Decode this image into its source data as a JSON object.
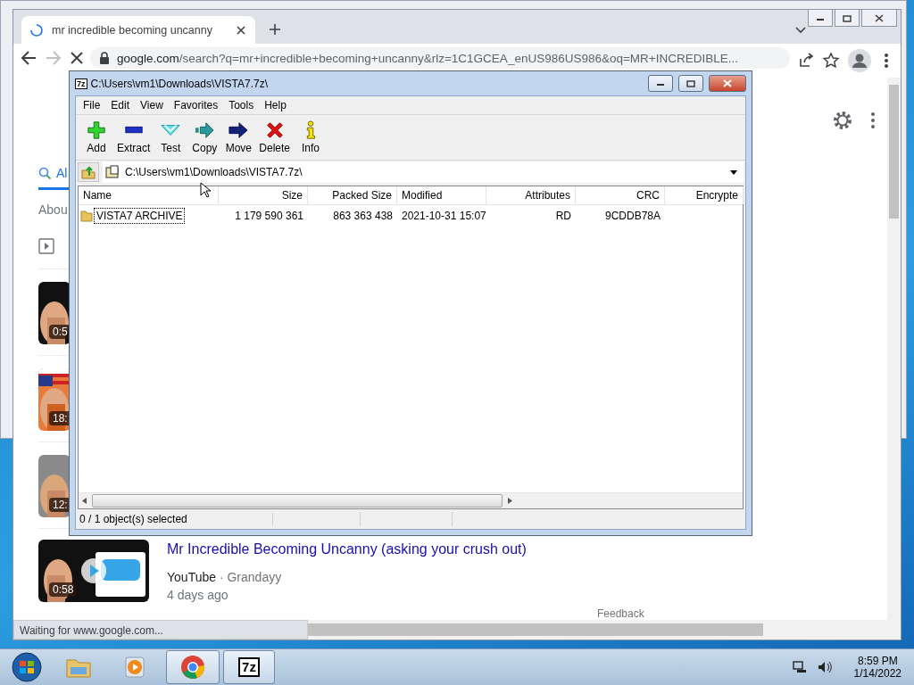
{
  "browser": {
    "tab": {
      "title": "mr incredible becoming uncanny",
      "selected": true
    },
    "address_host": "google.com",
    "address_rest": "/search?q=mr+incredible+becoming+uncanny&rlz=1C1GCEA_enUS986US986&oq=MR+INCREDIBLE...",
    "search_tab": "Al",
    "result_info": "Abou",
    "video_durations": [
      "0:5",
      "18:",
      "12:"
    ],
    "result": {
      "duration": "0:58",
      "title": "Mr Incredible Becoming Uncanny (asking your crush out)",
      "source": "YouTube",
      "separator": "·",
      "channel": "Grandayy",
      "age": "4 days ago"
    },
    "feedback": "Feedback",
    "status": "Waiting for www.google.com..."
  },
  "archiver": {
    "icon_text": "7z",
    "title": "C:\\Users\\vm1\\Downloads\\VISTA7.7z\\",
    "menu": [
      "File",
      "Edit",
      "View",
      "Favorites",
      "Tools",
      "Help"
    ],
    "toolbar": [
      {
        "label": "Add",
        "kind": "add"
      },
      {
        "label": "Extract",
        "kind": "extract"
      },
      {
        "label": "Test",
        "kind": "test"
      },
      {
        "label": "Copy",
        "kind": "copy"
      },
      {
        "label": "Move",
        "kind": "move"
      },
      {
        "label": "Delete",
        "kind": "delete"
      },
      {
        "label": "Info",
        "kind": "info"
      }
    ],
    "path": "C:\\Users\\vm1\\Downloads\\VISTA7.7z\\",
    "columns": [
      {
        "label": "Name",
        "kind": "name"
      },
      {
        "label": "Size",
        "kind": "size"
      },
      {
        "label": "Packed Size",
        "kind": "packed"
      },
      {
        "label": "Modified",
        "kind": "modified"
      },
      {
        "label": "Attributes",
        "kind": "attributes"
      },
      {
        "label": "CRC",
        "kind": "crc"
      },
      {
        "label": "Encrypte",
        "kind": "encrypted"
      }
    ],
    "rows": [
      {
        "cells": [
          "VISTA7 ARCHIVE",
          "1 179 590 361",
          "863 363 438",
          "2021-10-31 15:07",
          "RD",
          "9CDDB78A"
        ],
        "focused": true
      }
    ],
    "status": "0 / 1 object(s) selected"
  },
  "taskbar": {
    "apps": [
      {
        "kind": "explorer",
        "active": false
      },
      {
        "kind": "media",
        "active": false
      },
      {
        "kind": "chrome",
        "active": true
      },
      {
        "kind": "archiver",
        "label": "7z",
        "active": true
      }
    ],
    "time": "8:59 PM",
    "date": "1/14/2022"
  }
}
